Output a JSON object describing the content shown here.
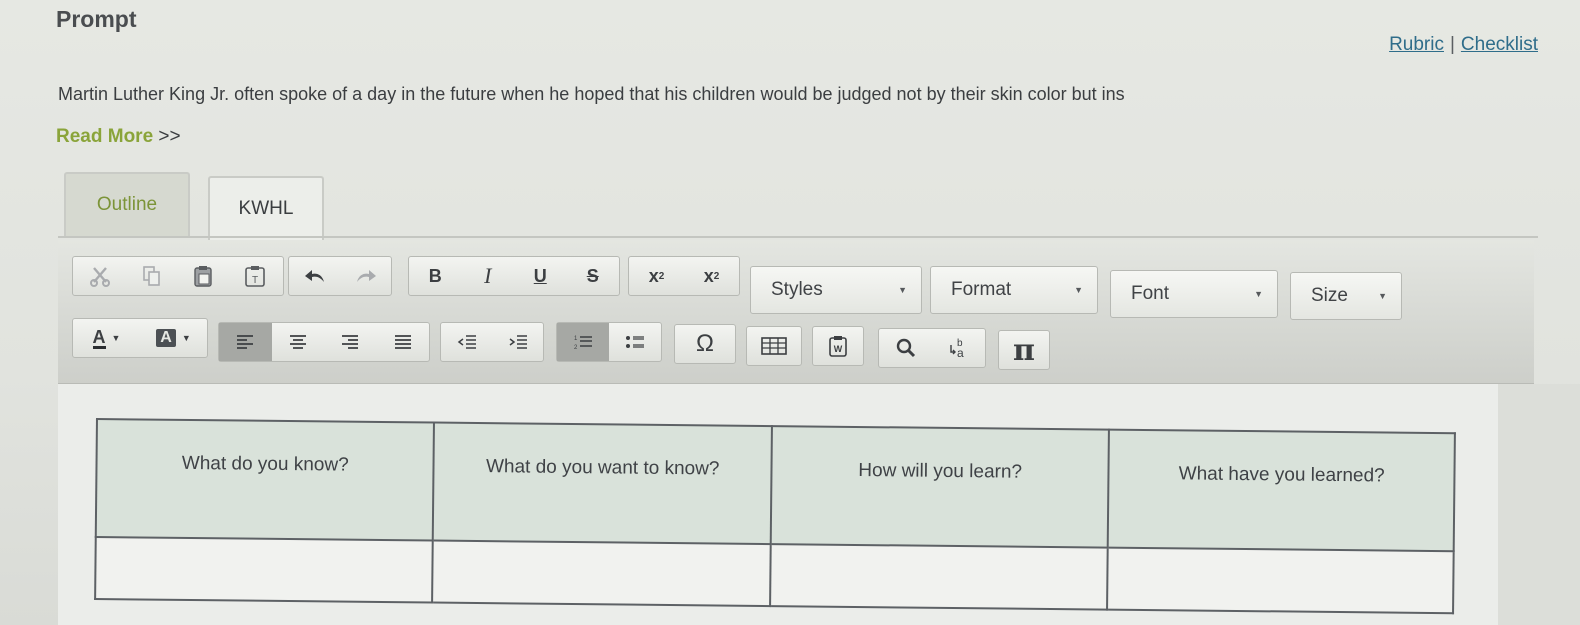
{
  "header": {
    "title": "Prompt",
    "rubric_label": "Rubric",
    "separator": "|",
    "checklist_label": "Checklist"
  },
  "prompt": {
    "text": "Martin Luther King Jr. often spoke of a day in the future when he hoped that his children would be judged not by their skin color but ins",
    "read_more": "Read More",
    "read_more_arrows": ">>"
  },
  "tabs": [
    {
      "label": "Outline",
      "active": false
    },
    {
      "label": "KWHL",
      "active": true
    }
  ],
  "toolbar": {
    "row1": {
      "cut": "cut-icon",
      "copy": "copy-icon",
      "paste": "paste-icon",
      "paste_text": "paste-text-icon",
      "undo": "undo-icon",
      "redo": "redo-icon",
      "bold": "B",
      "italic": "I",
      "underline": "U",
      "strike": "S",
      "subscript": "x",
      "subscript_sub": "2",
      "superscript": "x",
      "superscript_sup": "2",
      "styles": "Styles",
      "format": "Format",
      "font": "Font",
      "size": "Size"
    },
    "row2": {
      "text_color": "A",
      "bg_color": "A",
      "omega": "Ω",
      "pi": "π"
    }
  },
  "kwhl_table": {
    "headers": [
      "What do you know?",
      "What do you want to know?",
      "How will you learn?",
      "What have you learned?"
    ],
    "rows": [
      [
        "",
        "",
        "",
        ""
      ]
    ]
  },
  "colors": {
    "accent_green": "#8aa43a",
    "link_blue": "#2f6d8a",
    "table_header_bg": "#d9e2da"
  }
}
